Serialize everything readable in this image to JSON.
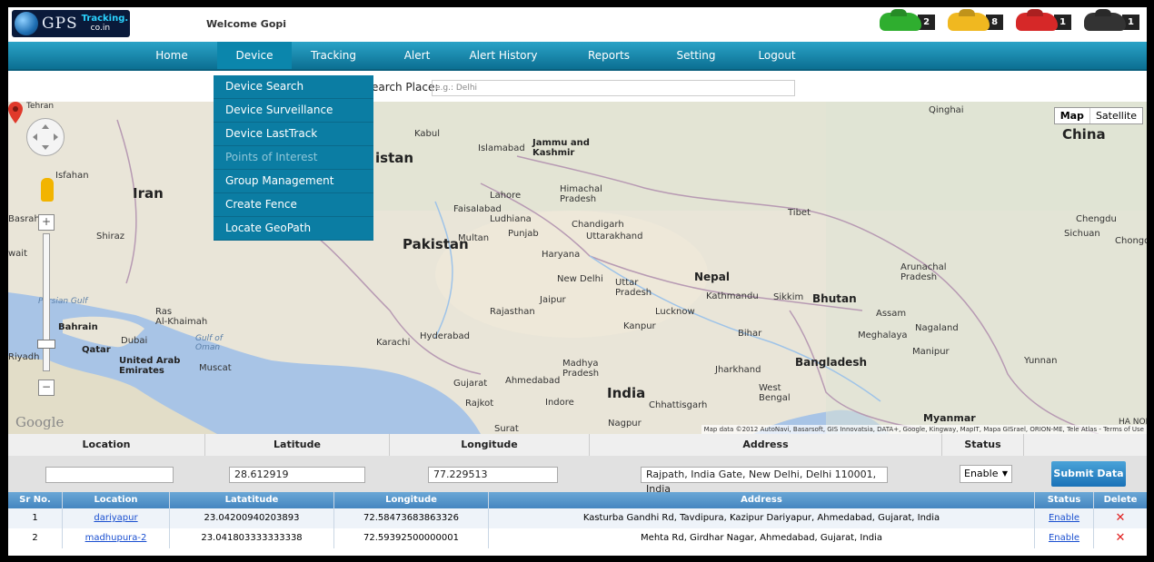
{
  "header": {
    "logo_main": "GPS",
    "logo_brand": "Tracking.",
    "logo_domain": "co.in",
    "welcome": "Welcome Gopi",
    "car_counts": [
      {
        "color": "#2fae2f",
        "count": "2"
      },
      {
        "color": "#f0b820",
        "count": "8"
      },
      {
        "color": "#d62828",
        "count": "1"
      },
      {
        "color": "#333333",
        "count": "1"
      }
    ]
  },
  "nav": {
    "items": [
      "Home",
      "Device",
      "Tracking",
      "Alert",
      "Alert History",
      "Reports",
      "Setting",
      "Logout"
    ],
    "active": "Device"
  },
  "search": {
    "label": "earch Place:",
    "placeholder": "e.g.: Delhi"
  },
  "device_menu": {
    "items": [
      "Device Search",
      "Device Surveillance",
      "Device LastTrack",
      "Points of Interest",
      "Group Management",
      "Create Fence",
      "Locate GeoPath"
    ],
    "disabled": "Points of Interest"
  },
  "map": {
    "type_buttons": [
      "Map",
      "Satellite"
    ],
    "labels": {
      "china": "China",
      "iran": "Iran",
      "pakistan": "Pakistan",
      "india": "India",
      "istan": "istan",
      "qinghai": "Qinghai",
      "tibet": "Tibet",
      "chengdu": "Chengdu",
      "sichuan": "Sichuan",
      "chongq": "Chongq",
      "kabul": "Kabul",
      "islamabad": "Islamabad",
      "jammu": "Jammu and\nKashmir",
      "himachal": "Himachal\nPradesh",
      "lahore": "Lahore",
      "faisalabad": "Faisalabad",
      "ludhiana": "Ludhiana",
      "chandigarh": "Chandigarh",
      "punjab": "Punjab",
      "uttarakhand": "Uttarakhand",
      "multan": "Multan",
      "haryana": "Haryana",
      "newdelhi": "New Delhi",
      "uttar": "Uttar\nPradesh",
      "nepal": "Nepal",
      "kathmandu": "Kathmandu",
      "sikkim": "Sikkim",
      "bhutan": "Bhutan",
      "arunachal": "Arunachal\nPradesh",
      "assam": "Assam",
      "nagaland": "Nagaland",
      "meghalaya": "Meghalaya",
      "manipur": "Manipur",
      "bihar": "Bihar",
      "lucknow": "Lucknow",
      "kanpur": "Kanpur",
      "jaipur": "Jaipur",
      "rajasthan": "Rajasthan",
      "isfahan": "Isfahan",
      "shiraz": "Shiraz",
      "basrah": "Basrah",
      "wait": "wait",
      "persian": "Persian Gulf",
      "ras": "Ras\nAl-Khaimah",
      "bahrain": "Bahrain",
      "dubai": "Dubai",
      "qatar": "Qatar",
      "riyadh": "Riyadh",
      "uae": "United Arab\nEmirates",
      "oman": "Gulf of\nOman",
      "muscat": "Muscat",
      "karachi": "Karachi",
      "hyderabad": "Hyderabad",
      "gujarat": "Gujarat",
      "ahmedabad": "Ahmedabad",
      "rajkot": "Rajkot",
      "surat": "Surat",
      "madhya": "Madhya\nPradesh",
      "indore": "Indore",
      "nagpur": "Nagpur",
      "chhattisgarh": "Chhattisgarh",
      "jharkhand": "Jharkhand",
      "west": "West\nBengal",
      "bangladesh": "Bangladesh",
      "myanmar": "Myanmar",
      "yunnan": "Yunnan",
      "hanoi": "HA NOI",
      "tehran": "Tehran"
    },
    "google": "Google",
    "attribution": "Map data ©2012 AutoNavi, Basarsoft, GIS Innovatsia, DATA+, Google, Kingway, MapIT, Mapa GISrael, ORION-ME, Tele Atlas - Terms of Use"
  },
  "form": {
    "headers": [
      "Location",
      "Latitude",
      "Longitude",
      "Address",
      "Status"
    ],
    "location_value": "",
    "latitude_value": "28.612919",
    "longitude_value": "77.229513",
    "address_value": "Rajpath, India Gate, New Delhi, Delhi 110001, India",
    "status_value": "Enable",
    "submit_label": "Submit Data"
  },
  "table": {
    "headers": [
      "Sr No.",
      "Location",
      "Latatitude",
      "Longitude",
      "Address",
      "Status",
      "Delete"
    ],
    "rows": [
      {
        "sr": "1",
        "location": "dariyapur",
        "lat": "23.04200940203893",
        "lng": "72.58473683863326",
        "address": "Kasturba Gandhi Rd, Tavdipura, Kazipur Dariyapur, Ahmedabad, Gujarat, India",
        "status": "Enable",
        "delete": "✕"
      },
      {
        "sr": "2",
        "location": "madhupura-2",
        "lat": "23.041803333333338",
        "lng": "72.59392500000001",
        "address": "Mehta Rd, Girdhar Nagar, Ahmedabad, Gujarat, India",
        "status": "Enable",
        "delete": "✕"
      }
    ]
  }
}
